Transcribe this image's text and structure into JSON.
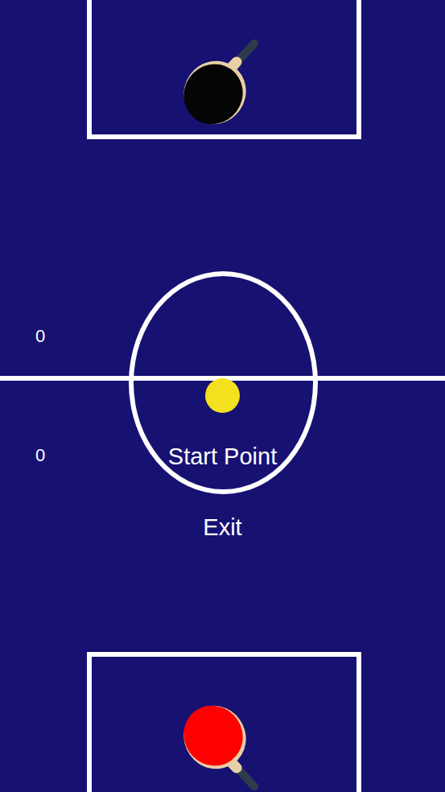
{
  "scores": [
    {
      "player": "opponent",
      "value": "0"
    },
    {
      "player": "player",
      "value": "0"
    }
  ],
  "paddles": [
    {
      "side": "top",
      "color": "#050505"
    },
    {
      "side": "bottom",
      "color": "#ff0000"
    }
  ],
  "menu": [
    {
      "label": "Start Point",
      "selected": false
    },
    {
      "label": "Exit",
      "selected": false
    }
  ]
}
